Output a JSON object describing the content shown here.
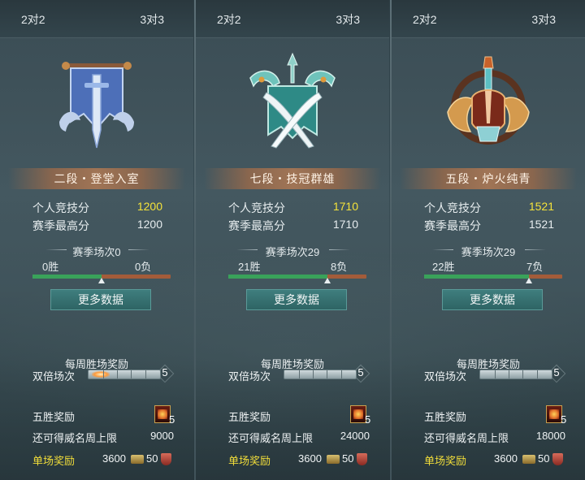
{
  "panels": [
    {
      "tabs": [
        "2对2",
        "3对3"
      ],
      "rank": "二段・登堂入室",
      "score_label": "个人竞技分",
      "score": "1200",
      "best_label": "赛季最高分",
      "best": "1200",
      "season_title": "赛季场次0",
      "wins": "0胜",
      "losses": "0负",
      "win_fraction": 0.5,
      "more_label": "更多数据",
      "weekly_title": "每周胜场奖励",
      "double_label": "双倍场次",
      "double_count": "5",
      "five_label": "五胜奖励",
      "five_count": "5",
      "cap_label": "还可得威名周上限",
      "cap": "9000",
      "single_label": "单场奖励",
      "single_a": "3600",
      "single_b": "50"
    },
    {
      "tabs": [
        "2对2",
        "3对3"
      ],
      "rank": "七段・技冠群雄",
      "score_label": "个人竞技分",
      "score": "1710",
      "best_label": "赛季最高分",
      "best": "1710",
      "season_title": "赛季场次29",
      "wins": "21胜",
      "losses": "8负",
      "win_fraction": 0.72,
      "more_label": "更多数据",
      "weekly_title": "每周胜场奖励",
      "double_label": "双倍场次",
      "double_count": "5",
      "five_label": "五胜奖励",
      "five_count": "5",
      "cap_label": "还可得威名周上限",
      "cap": "24000",
      "single_label": "单场奖励",
      "single_a": "3600",
      "single_b": "50"
    },
    {
      "tabs": [
        "2对2",
        "3对3"
      ],
      "rank": "五段・炉火纯青",
      "score_label": "个人竞技分",
      "score": "1521",
      "best_label": "赛季最高分",
      "best": "1521",
      "season_title": "赛季场次29",
      "wins": "22胜",
      "losses": "7负",
      "win_fraction": 0.76,
      "more_label": "更多数据",
      "weekly_title": "每周胜场奖励",
      "double_label": "双倍场次",
      "double_count": "5",
      "five_label": "五胜奖励",
      "five_count": "5",
      "cap_label": "还可得威名周上限",
      "cap": "18000",
      "single_label": "单场奖励",
      "single_a": "3600",
      "single_b": "50"
    }
  ],
  "colors": {
    "score_highlight": "#f4e23a",
    "single_reward_label": "#f0dc3a",
    "win_bar": "#39a25a",
    "loss_bar": "#a35c3a"
  },
  "emblems": [
    "blue-banner-sword-emblem",
    "crossed-swords-emblem",
    "bronze-winged-sword-emblem"
  ]
}
